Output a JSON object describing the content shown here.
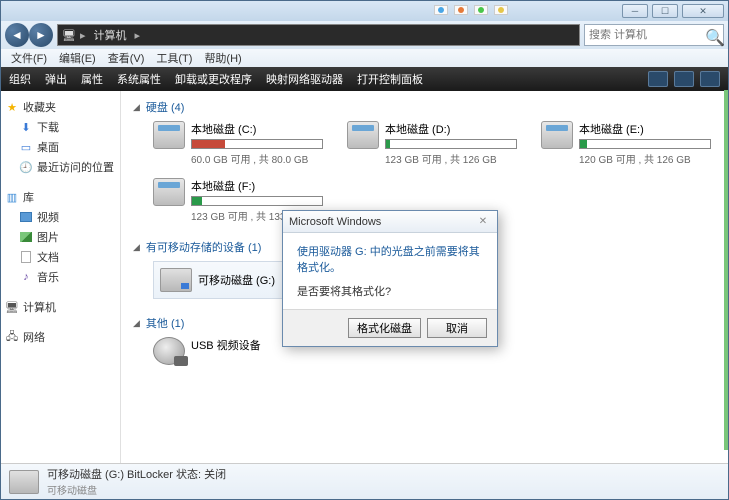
{
  "taskbar_items": [
    {
      "color": "#4aa6e6"
    },
    {
      "color": "#e67a3a"
    },
    {
      "color": "#4ac64a"
    },
    {
      "color": "#e6c64a",
      "label": "搜索 计算机"
    }
  ],
  "window": {
    "breadcrumb_seg": "计算机",
    "search_placeholder": "搜索 计算机"
  },
  "menu": {
    "file": "文件(F)",
    "edit": "编辑(E)",
    "view": "查看(V)",
    "tools": "工具(T)",
    "help": "帮助(H)"
  },
  "toolbar": {
    "org": "组织",
    "eject": "弹出",
    "props": "属性",
    "sysprops": "系统属性",
    "addrem": "卸载或更改程序",
    "mapnet": "映射网络驱动器",
    "ctrlpnl": "打开控制面板"
  },
  "sidebar": {
    "fav": "收藏夹",
    "downloads": "下载",
    "desktop": "桌面",
    "recent": "最近访问的位置",
    "libs": "库",
    "video": "视频",
    "pictures": "图片",
    "docs": "文档",
    "music": "音乐",
    "computer": "计算机",
    "network": "网络"
  },
  "sections": {
    "hdd_label": "硬盘 (4)",
    "removable_label": "有可移动存储的设备 (1)",
    "other_label": "其他 (1)"
  },
  "drives": [
    {
      "name": "本地磁盘 (C:)",
      "free": "60.0 GB 可用 , 共 80.0 GB",
      "pct": 25,
      "red": true
    },
    {
      "name": "本地磁盘 (D:)",
      "free": "123 GB 可用 , 共 126 GB",
      "pct": 3,
      "red": false
    },
    {
      "name": "本地磁盘 (E:)",
      "free": "120 GB 可用 , 共 126 GB",
      "pct": 5,
      "red": false
    },
    {
      "name": "本地磁盘 (F:)",
      "free": "123 GB 可用 , 共 133 GB",
      "pct": 8,
      "red": false
    }
  ],
  "removable": {
    "name": "可移动磁盘 (G:)"
  },
  "other": {
    "name": "USB 视频设备"
  },
  "status": {
    "line1": "可移动磁盘 (G:) BitLocker 状态: 关闭",
    "line2": "可移动磁盘"
  },
  "dialog": {
    "title": "Microsoft Windows",
    "main": "使用驱动器 G: 中的光盘之前需要将其格式化。",
    "secondary": "是否要将其格式化?",
    "btn_format": "格式化磁盘",
    "btn_cancel": "取消"
  }
}
